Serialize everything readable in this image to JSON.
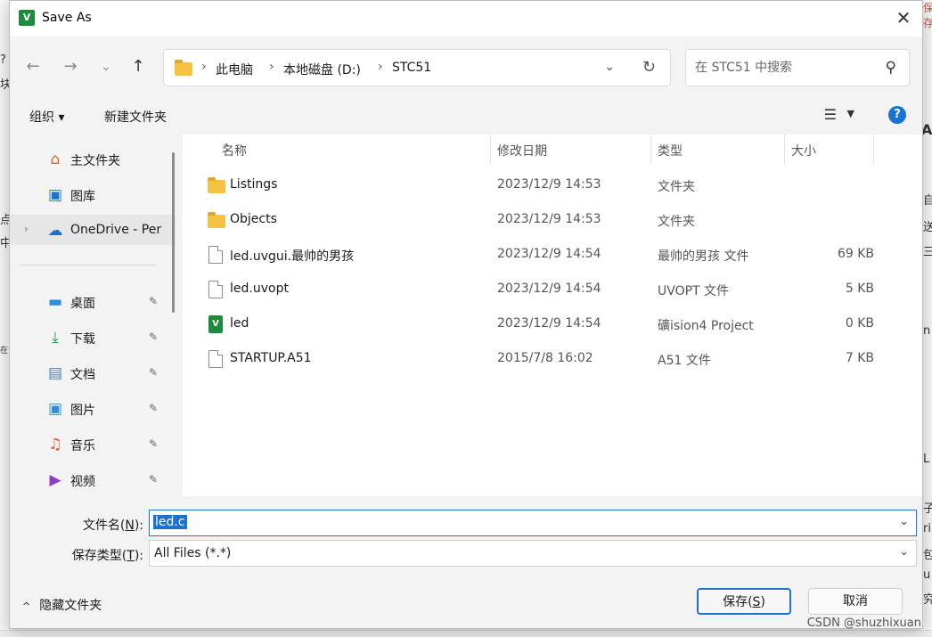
{
  "window": {
    "title": "Save As",
    "app_icon": "uvision-icon",
    "close_symbol": "✕"
  },
  "nav": {
    "back_symbol": "←",
    "forward_symbol": "→",
    "recent_symbol": "⌄",
    "up_symbol": "↑",
    "breadcrumb": [
      "此电脑",
      "本地磁盘 (D:)",
      "STC51"
    ],
    "breadcrumb_sep": "›",
    "dropdown_symbol": "⌄",
    "refresh_symbol": "↻",
    "search_placeholder": "在 STC51 中搜索",
    "search_symbol": "⚲"
  },
  "toolbar": {
    "organize_label": "组织 ▾",
    "new_folder_label": "新建文件夹",
    "view_symbol": "☰",
    "view_drop_symbol": "▼",
    "help_symbol": "?"
  },
  "sidebar": {
    "items": [
      {
        "label": "主文件夹",
        "icon": "home-icon",
        "symbol": "⌂",
        "color": "#d2691e"
      },
      {
        "label": "图库",
        "icon": "gallery-icon",
        "symbol": "▣",
        "color": "#1a73d1"
      },
      {
        "label": "OneDrive - Per",
        "icon": "onedrive-icon",
        "symbol": "☁",
        "color": "#1a73d1",
        "expand": "›"
      },
      {
        "label": "桌面",
        "icon": "desktop-icon",
        "symbol": "▬",
        "color": "#2b8ed6",
        "pinned": true
      },
      {
        "label": "下载",
        "icon": "download-icon",
        "symbol": "⤓",
        "color": "#1c9b5a",
        "pinned": true
      },
      {
        "label": "文档",
        "icon": "documents-icon",
        "symbol": "▤",
        "color": "#4a7db5",
        "pinned": true
      },
      {
        "label": "图片",
        "icon": "pictures-icon",
        "symbol": "▣",
        "color": "#2b8ed6",
        "pinned": true
      },
      {
        "label": "音乐",
        "icon": "music-icon",
        "symbol": "♫",
        "color": "#e0552d",
        "pinned": true
      },
      {
        "label": "视频",
        "icon": "videos-icon",
        "symbol": "▶",
        "color": "#8a3fc2",
        "pinned": true
      }
    ],
    "pin_symbol": "✎"
  },
  "filelist": {
    "columns": [
      "名称",
      "修改日期",
      "类型",
      "大小"
    ],
    "sort_symbol": "^",
    "rows": [
      {
        "name": "Listings",
        "date": "2023/12/9 14:53",
        "type": "文件夹",
        "size": "",
        "icon": "folder-icon"
      },
      {
        "name": "Objects",
        "date": "2023/12/9 14:53",
        "type": "文件夹",
        "size": "",
        "icon": "folder-icon"
      },
      {
        "name": "led.uvgui.最帅的男孩",
        "date": "2023/12/9 14:54",
        "type": "最帅的男孩 文件",
        "size": "69 KB",
        "icon": "file-icon"
      },
      {
        "name": "led.uvopt",
        "date": "2023/12/9 14:54",
        "type": "UVOPT 文件",
        "size": "5 KB",
        "icon": "file-icon"
      },
      {
        "name": "led",
        "date": "2023/12/9 14:54",
        "type": "礦ision4 Project",
        "size": "0 KB",
        "icon": "uvision-project-icon"
      },
      {
        "name": "STARTUP.A51",
        "date": "2015/7/8 16:02",
        "type": "A51 文件",
        "size": "7 KB",
        "icon": "file-icon"
      }
    ]
  },
  "form": {
    "filename_label": "文件名(",
    "filename_key": "N",
    "filename_label_end": "):",
    "filename_value": "led.c",
    "filetype_label": "保存类型(",
    "filetype_key": "T",
    "filetype_label_end": "):",
    "filetype_value": "All Files (*.*)",
    "dropdown_symbol": "⌄",
    "hide_folders_label": "隐藏文件夹",
    "hide_folders_symbol": "^",
    "save_label": "保存(",
    "save_key": "S",
    "save_label_end": ")",
    "cancel_label": "取消"
  },
  "watermark": "CSDN @shuzhixuan",
  "background_fragments": [
    "?",
    "块",
    "点",
    "中",
    "在",
    "AI",
    "自",
    "三",
    "送",
    "L",
    "n",
    "子",
    "ri",
    "包",
    "u",
    "究",
    "保存"
  ]
}
